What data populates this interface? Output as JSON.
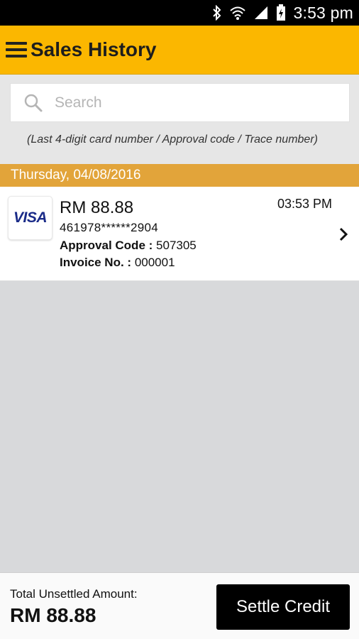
{
  "status_bar": {
    "time": "3:53 pm",
    "icons": [
      "bluetooth-icon",
      "wifi-icon",
      "signal-icon",
      "battery-icon"
    ]
  },
  "app_bar": {
    "title": "Sales History",
    "menu_icon": "hamburger-menu-icon"
  },
  "search": {
    "placeholder": "Search",
    "value": "",
    "icon": "search-icon",
    "hint": "(Last 4-digit card number / Approval code / Trace number)"
  },
  "colors": {
    "accent": "#fbb700",
    "date_header": "#e2a43a",
    "visa_blue": "#1a2b88"
  },
  "transactions": [
    {
      "date": "Thursday, 04/08/2016",
      "card_brand": "VISA",
      "amount": "RM 88.88",
      "time": "03:53 PM",
      "card_number": "461978******2904",
      "approval_label": "Approval Code :",
      "approval_code": "507305",
      "invoice_label": "Invoice No. :",
      "invoice_no": "000001"
    }
  ],
  "footer": {
    "total_label": "Total Unsettled Amount:",
    "total_value": "RM 88.88",
    "settle_label": "Settle Credit"
  }
}
